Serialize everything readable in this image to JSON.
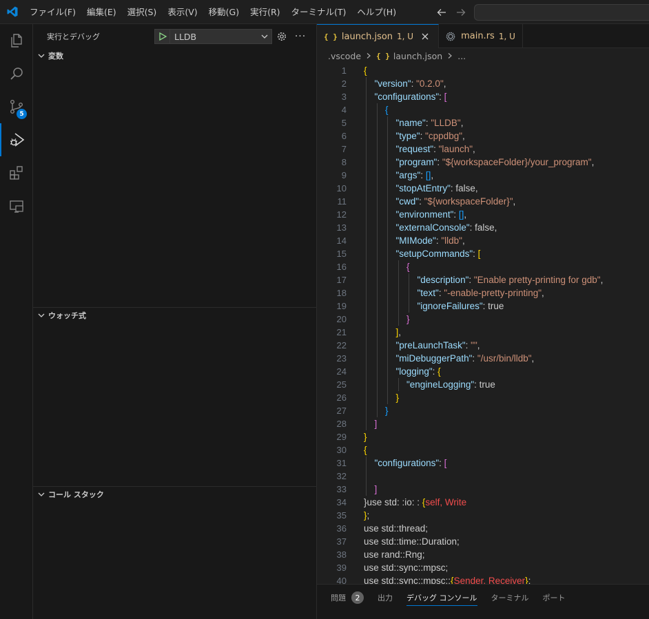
{
  "menu": [
    "ファイル(F)",
    "編集(E)",
    "選択(S)",
    "表示(V)",
    "移動(G)",
    "実行(R)",
    "ターミナル(T)",
    "ヘルプ(H)"
  ],
  "activity": {
    "scm_badge": "5"
  },
  "sidebar": {
    "title": "実行とデバッグ",
    "config": "LLDB",
    "sections": [
      "変数",
      "ウォッチ式",
      "コール スタック"
    ]
  },
  "tabs": [
    {
      "icon": "{ }",
      "label": "launch.json",
      "status": "1, U"
    },
    {
      "icon": "rust",
      "label": "main.rs",
      "status": "1, U"
    }
  ],
  "breadcrumb": {
    "folder": ".vscode",
    "icon": "{ }",
    "file": "launch.json",
    "more": "..."
  },
  "code": [
    "{",
    "\"version\": \"0.2.0\",",
    "\"configurations\": [",
    "{",
    "\"name\": \"LLDB\",",
    "\"type\": \"cppdbg\",",
    "\"request\": \"launch\",",
    "\"program\": \"${workspaceFolder}/your_program\",",
    "\"args\": [],",
    "\"stopAtEntry\": false,",
    "\"cwd\": \"${workspaceFolder}\",",
    "\"environment\": [],",
    "\"externalConsole\": false,",
    "\"MIMode\": \"lldb\",",
    "\"setupCommands\": [",
    "{",
    "\"description\": \"Enable pretty-printing for gdb\",",
    "\"text\": \"-enable-pretty-printing\",",
    "\"ignoreFailures\": true",
    "}",
    "],",
    "\"preLaunchTask\": \"\",",
    "\"miDebuggerPath\": \"/usr/bin/lldb\",",
    "\"logging\": {",
    "\"engineLogging\": true",
    "}",
    "}",
    "]",
    "}",
    "{",
    "\"configurations\": [",
    "",
    "]",
    "}use std: :io: : {self, Write",
    "};",
    "use std::thread;",
    "use std::time::Duration;",
    "use rand::Rng;",
    "use std::sync::mpsc;",
    "use std::sync::mpsc::{Sender, Receiver};"
  ],
  "panel": {
    "tabs": [
      "問題",
      "出力",
      "デバッグ コンソール",
      "ターミナル",
      "ポート"
    ],
    "problems_count": "2"
  },
  "colors": {
    "accent": "#0078d4",
    "key": "#9cdcfe",
    "string": "#ce9178",
    "bool": "#569cd6"
  }
}
